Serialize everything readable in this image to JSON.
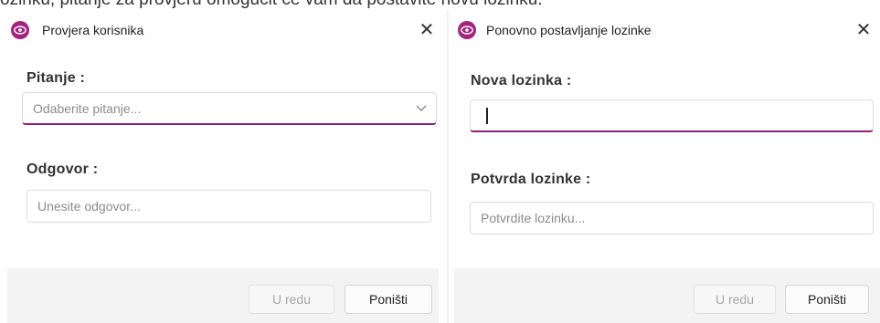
{
  "background_text": "ozinku, pitanje za provjeru omogućit će vam da postavite novu lozinku.",
  "colors": {
    "accent": "#8e1e7a",
    "app_icon": "#a4237f"
  },
  "left_dialog": {
    "title": "Provjera korisnika",
    "icon": "eye-icon",
    "close_label": "✕",
    "question_label": "Pitanje :",
    "question_placeholder": "Odaberite pitanje...",
    "question_chevron": "chevron-down-icon",
    "answer_label": "Odgovor :",
    "answer_placeholder": "Unesite odgovor...",
    "ok_label": "U redu",
    "cancel_label": "Poništi"
  },
  "right_dialog": {
    "title": "Ponovno postavljanje lozinke",
    "icon": "eye-icon",
    "close_label": "✕",
    "new_password_label": "Nova lozinka :",
    "new_password_value": "",
    "confirm_label": "Potvrda lozinke :",
    "confirm_placeholder": "Potvrdite lozinku...",
    "ok_label": "U redu",
    "cancel_label": "Poništi"
  }
}
